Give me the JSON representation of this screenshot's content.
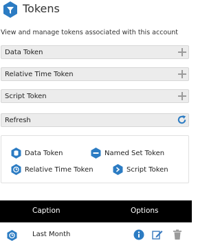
{
  "header": {
    "title": "Tokens",
    "icon": "filter-hex-icon"
  },
  "description": "View and manage tokens associated with this account",
  "sections": [
    {
      "label": "Data Token"
    },
    {
      "label": "Relative Time Token"
    },
    {
      "label": "Script Token"
    }
  ],
  "refresh": {
    "label": "Refresh"
  },
  "legend": {
    "data_token": "Data Token",
    "named_set_token": "Named Set Token",
    "relative_time_token": "Relative Time Token",
    "script_token": "Script Token"
  },
  "table": {
    "columns": [
      "Caption",
      "Options"
    ],
    "rows": [
      {
        "caption": "Last Month",
        "type_icon": "clock-hex-icon"
      }
    ]
  },
  "colors": {
    "accent": "#2c7cc3",
    "header_bg": "#000000"
  }
}
